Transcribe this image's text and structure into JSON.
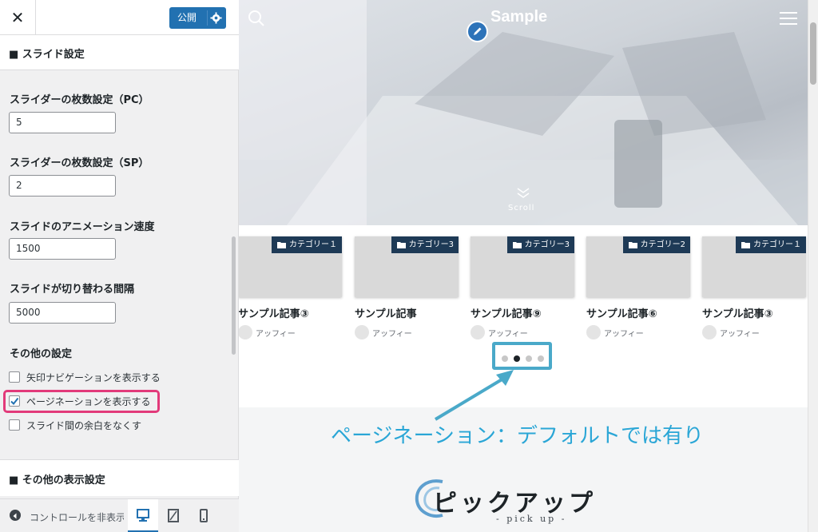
{
  "header": {
    "close_icon": "close-icon",
    "publish_label": "公開",
    "settings_icon": "gear-icon",
    "accent_color": "#2271b1"
  },
  "section1": {
    "title": "■ スライド設定"
  },
  "fields": [
    {
      "label": "スライダーの枚数設定（PC）",
      "value": "5"
    },
    {
      "label": "スライダーの枚数設定（SP）",
      "value": "2"
    },
    {
      "label": "スライドのアニメーション速度",
      "value": "1500"
    },
    {
      "label": "スライドが切り替わる間隔",
      "value": "5000"
    }
  ],
  "other": {
    "title": "その他の設定",
    "options": [
      {
        "label": "矢印ナビゲーションを表示する",
        "checked": false
      },
      {
        "label": "ページネーションを表示する",
        "checked": true
      },
      {
        "label": "スライド間の余白をなくす",
        "checked": false
      }
    ]
  },
  "section2": {
    "title": "■ その他の表示設定"
  },
  "footer": {
    "hide_controls_label": "コントロールを非表示",
    "devices": [
      "desktop-icon",
      "tablet-icon",
      "mobile-icon"
    ]
  },
  "preview": {
    "site_title": "Sample",
    "scroll_label": "Scroll",
    "cards": [
      {
        "category": "カテゴリー１",
        "title": "サンプル記事③",
        "author": "アッフィー"
      },
      {
        "category": "カテゴリー3",
        "title": "サンプル記事",
        "author": "アッフィー"
      },
      {
        "category": "カテゴリー3",
        "title": "サンプル記事⑨",
        "author": "アッフィー"
      },
      {
        "category": "カテゴリー2",
        "title": "サンプル記事⑥",
        "author": "アッフィー"
      },
      {
        "category": "カテゴリー１",
        "title": "サンプル記事③",
        "author": "アッフィー"
      }
    ],
    "pagination": {
      "total": 4,
      "active": 2
    },
    "annotation": "ページネーション：デフォルトでは有り",
    "pickup_title": "ピックアップ",
    "pickup_sub": "- pick up -"
  }
}
